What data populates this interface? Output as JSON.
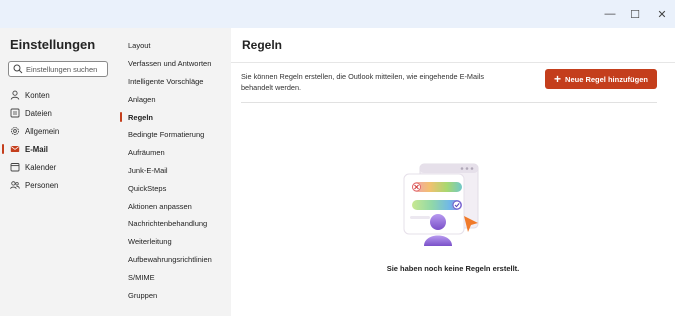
{
  "window": {
    "minimize_glyph": "—",
    "maximize_glyph": "☐",
    "close_glyph": "✕"
  },
  "settings": {
    "title": "Einstellungen",
    "search_placeholder": "Einstellungen suchen",
    "categories": [
      {
        "label": "Konten",
        "icon": "person-icon"
      },
      {
        "label": "Dateien",
        "icon": "file-icon"
      },
      {
        "label": "Allgemein",
        "icon": "gear-icon"
      },
      {
        "label": "E-Mail",
        "icon": "mail-icon",
        "active": true
      },
      {
        "label": "Kalender",
        "icon": "calendar-icon"
      },
      {
        "label": "Personen",
        "icon": "people-icon"
      }
    ]
  },
  "subnav": {
    "items": [
      "Layout",
      "Verfassen und Antworten",
      "Intelligente Vorschläge",
      "Anlagen",
      "Regeln",
      "Bedingte Formatierung",
      "Aufräumen",
      "Junk-E-Mail",
      "QuickSteps",
      "Aktionen anpassen",
      "Nachrichtenbehandlung",
      "Weiterleitung",
      "Aufbewahrungsrichtlinien",
      "S/MIME",
      "Gruppen"
    ],
    "active_index": 4
  },
  "content": {
    "title": "Regeln",
    "description": "Sie können Regeln erstellen, die Outlook mitteilen, wie eingehende E-Mails behandelt werden.",
    "add_button_label": "Neue Regel hinzufügen",
    "empty_message": "Sie haben noch keine Regeln erstellt."
  },
  "colors": {
    "accent": "#c43e1c",
    "content_bg": "#ffffff",
    "nav_bg": "#f3f3f3",
    "titlebar_bg": "#eaf1fb"
  }
}
